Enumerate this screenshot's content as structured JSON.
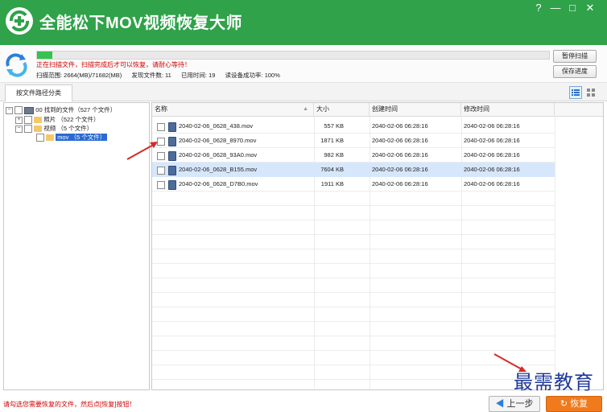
{
  "app": {
    "title": "全能松下MOV视频恢复大师"
  },
  "window": {
    "help": "?",
    "minimize": "—",
    "maximize": "□",
    "close": "✕"
  },
  "scan": {
    "progress": 0.03,
    "status_message": "正在扫描文件，扫描完成后才可以恢复，请耐心等待！",
    "range": "扫描范围: 2664(MB)/71682(MB)",
    "found": "发现文件数: 11",
    "elapsed": "已用时间: 19",
    "read_rate": "读设备成功率: 100%",
    "pause_label": "暂停扫描",
    "save_label": "保存进度"
  },
  "tabs": [
    {
      "label": "按文件路径分类"
    }
  ],
  "tree": {
    "root": "00 找到的文件（527 个文件）",
    "photos": "照片   （522 个文件）",
    "videos": "视频   （5 个文件）",
    "mov": "mov   （5 个文件）"
  },
  "columns": {
    "name": "名称",
    "size": "大小",
    "created": "创建时间",
    "modified": "修改时间"
  },
  "files": [
    {
      "name": "2040-02-06_0628_438.mov",
      "size": "557 KB",
      "created": "2040-02-06   06:28:16",
      "modified": "2040-02-06   06:28:16"
    },
    {
      "name": "2040-02-06_0628_8970.mov",
      "size": "1871 KB",
      "created": "2040-02-06   06:28:16",
      "modified": "2040-02-06   06:28:16"
    },
    {
      "name": "2040-02-06_0628_93A0.mov",
      "size": "982 KB",
      "created": "2040-02-06   06:28:16",
      "modified": "2040-02-06   06:28:16"
    },
    {
      "name": "2040-02-06_0628_B155.mov",
      "size": "7604 KB",
      "created": "2040-02-06   06:28:16",
      "modified": "2040-02-06   06:28:16"
    },
    {
      "name": "2040-02-06_0628_D7B0.mov",
      "size": "1911 KB",
      "created": "2040-02-06   06:28:16",
      "modified": "2040-02-06   06:28:16"
    }
  ],
  "footer": {
    "hint": "请勾选您需要恢复的文件，然后点[恢复]按钮！",
    "prev_label": "上一步",
    "recover_label": "恢复"
  },
  "watermark": "最需教育",
  "colors": {
    "title_bar": "#2fa24a",
    "accent_red": "#d40000",
    "recover_button": "#f07a1c",
    "selection": "#d7e7fb"
  }
}
